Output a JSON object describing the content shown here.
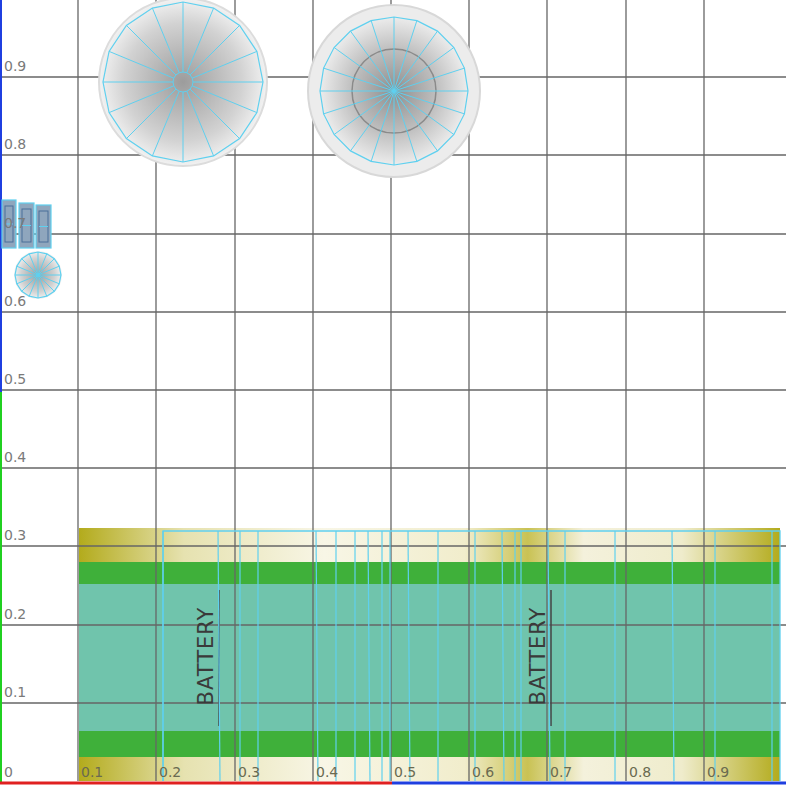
{
  "axes": {
    "origin": "0",
    "x_ticks": [
      "0.1",
      "0.2",
      "0.3",
      "0.4",
      "0.5",
      "0.6",
      "0.7",
      "0.8",
      "0.9"
    ],
    "y_ticks": [
      "0.1",
      "0.2",
      "0.3",
      "0.4",
      "0.5",
      "0.6",
      "0.7",
      "0.8",
      "0.9"
    ]
  },
  "texture": {
    "labels": [
      "BATTERY",
      "BATTERY"
    ]
  }
}
